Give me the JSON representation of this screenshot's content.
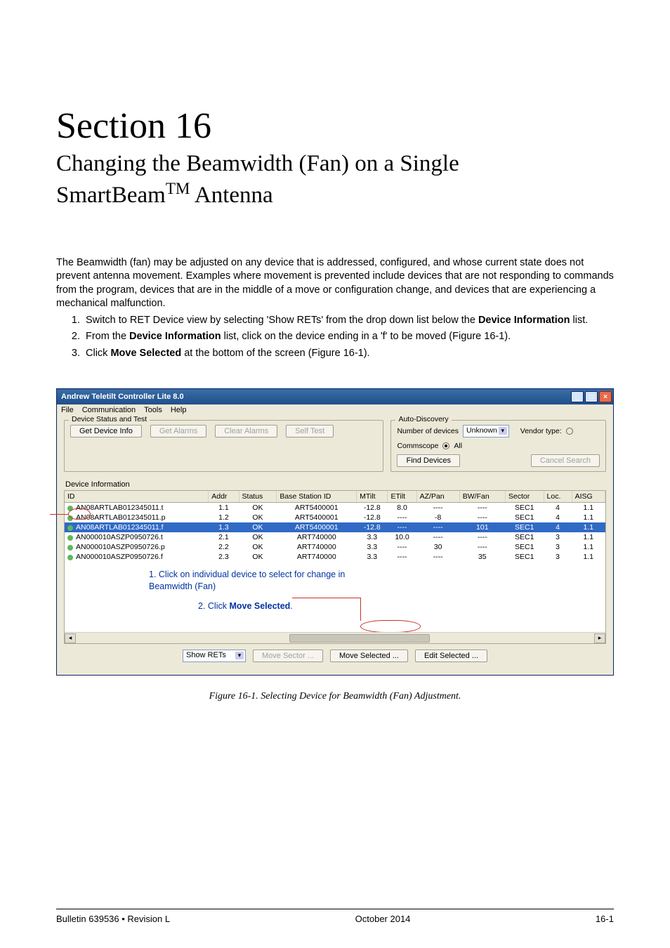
{
  "section": {
    "label": "Section 16",
    "title_line1": "Changing the Beamwidth (Fan) on a Single",
    "title_line2": "SmartBeam",
    "title_suffix": " Antenna"
  },
  "intro": "The Beamwidth (fan) may be adjusted on any device that is addressed, configured, and whose current state does not prevent antenna movement. Examples where movement is prevented include devices that are not responding to commands from the program, devices that are in the middle of a move or configuration change, and devices that are experiencing a mechanical malfunction.",
  "steps": [
    {
      "pre": "Switch to RET Device view by selecting 'Show RETs' from the drop down list below the ",
      "bold": "Device Information",
      "post": " list."
    },
    {
      "pre": "From the ",
      "bold": "Device Information",
      "post": " list, click on the device ending in a 'f' to be moved (Figure 16-1)."
    },
    {
      "pre": "Click ",
      "bold": "Move Selected",
      "post": " at the bottom of the screen (Figure 16-1)."
    }
  ],
  "app": {
    "title": "Andrew Teletilt Controller Lite 8.0",
    "menus": [
      "File",
      "Communication",
      "Tools",
      "Help"
    ],
    "dev_status_legend": "Device Status and Test",
    "btn_get_info": "Get Device Info",
    "btn_get_alarms": "Get Alarms",
    "btn_clear_alarms": "Clear Alarms",
    "btn_self_test": "Self Test",
    "autodisc_legend": "Auto-Discovery",
    "autodisc_num_label": "Number of devices",
    "autodisc_select": "Unknown",
    "vendor_label": "Vendor type:",
    "vendor_commscope": "Commscope",
    "vendor_all": "All",
    "btn_find": "Find Devices",
    "btn_cancel_search": "Cancel Search",
    "di_label": "Device Information",
    "headers": [
      "ID",
      "Addr",
      "Status",
      "Base Station ID",
      "MTilt",
      "ETilt",
      "AZ/Pan",
      "BW/Fan",
      "Sector",
      "Loc.",
      "AISG"
    ],
    "rows": [
      {
        "id": "AN08ARTLAB012345011.t",
        "addr": "1.1",
        "status": "OK",
        "bs": "ART5400001",
        "mtilt": "-12.8",
        "etilt": "8.0",
        "az": "----",
        "bw": "----",
        "sec": "SEC1",
        "loc": "4",
        "aisg": "1.1",
        "sel": false
      },
      {
        "id": "AN08ARTLAB012345011.p",
        "addr": "1.2",
        "status": "OK",
        "bs": "ART5400001",
        "mtilt": "-12.8",
        "etilt": "----",
        "az": "-8",
        "bw": "----",
        "sec": "SEC1",
        "loc": "4",
        "aisg": "1.1",
        "sel": false
      },
      {
        "id": "AN08ARTLAB012345011.f",
        "addr": "1.3",
        "status": "OK",
        "bs": "ART5400001",
        "mtilt": "-12.8",
        "etilt": "----",
        "az": "----",
        "bw": "101",
        "sec": "SEC1",
        "loc": "4",
        "aisg": "1.1",
        "sel": true
      },
      {
        "id": "AN000010ASZP0950726.t",
        "addr": "2.1",
        "status": "OK",
        "bs": "ART740000",
        "mtilt": "3.3",
        "etilt": "10.0",
        "az": "----",
        "bw": "----",
        "sec": "SEC1",
        "loc": "3",
        "aisg": "1.1",
        "sel": false
      },
      {
        "id": "AN000010ASZP0950726.p",
        "addr": "2.2",
        "status": "OK",
        "bs": "ART740000",
        "mtilt": "3.3",
        "etilt": "----",
        "az": "30",
        "bw": "----",
        "sec": "SEC1",
        "loc": "3",
        "aisg": "1.1",
        "sel": false
      },
      {
        "id": "AN000010ASZP0950726.f",
        "addr": "2.3",
        "status": "OK",
        "bs": "ART740000",
        "mtilt": "3.3",
        "etilt": "----",
        "az": "----",
        "bw": "35",
        "sec": "SEC1",
        "loc": "3",
        "aisg": "1.1",
        "sel": false
      }
    ],
    "show_select": "Show RETs",
    "btn_move_sector": "Move Sector ...",
    "btn_move_selected": "Move Selected ...",
    "btn_edit_selected": "Edit Selected ..."
  },
  "annotations": {
    "a1_line1": "1. Click on individual device to select for change in",
    "a1_line2": "Beamwidth (Fan)",
    "a2_pre": "2. Click ",
    "a2_bold": "Move Selected",
    "a2_post": "."
  },
  "caption": "Figure 16-1. Selecting Device for  Beamwidth (Fan) Adjustment.",
  "footer": {
    "left": "Bulletin 639536  •  Revision L",
    "center": "October 2014",
    "right": "16-1"
  }
}
